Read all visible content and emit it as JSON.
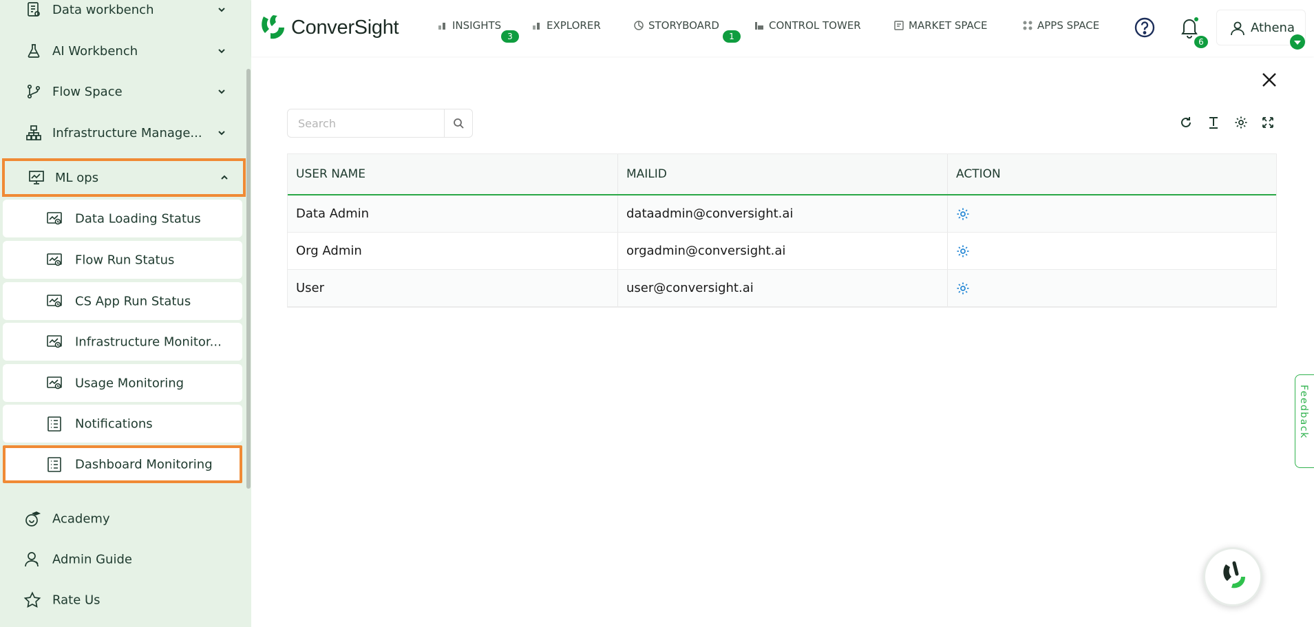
{
  "sidebar": {
    "items": [
      {
        "label": "Data workbench",
        "icon": "data-workbench-icon"
      },
      {
        "label": "AI Workbench",
        "icon": "flask-icon"
      },
      {
        "label": "Flow Space",
        "icon": "branch-icon"
      },
      {
        "label": "Infrastructure Manage...",
        "icon": "hierarchy-icon"
      },
      {
        "label": "ML ops",
        "icon": "presentation-chart-icon"
      }
    ],
    "sub_items": [
      {
        "label": "Data Loading Status"
      },
      {
        "label": "Flow Run Status"
      },
      {
        "label": "CS App Run Status"
      },
      {
        "label": "Infrastructure Monitor..."
      },
      {
        "label": "Usage Monitoring"
      },
      {
        "label": "Notifications"
      },
      {
        "label": "Dashboard Monitoring"
      }
    ],
    "footer": [
      {
        "label": "Academy"
      },
      {
        "label": "Admin Guide"
      },
      {
        "label": "Rate Us"
      }
    ]
  },
  "header": {
    "brand": "ConverSight",
    "nav": [
      {
        "label": "INSIGHTS",
        "badge": "3"
      },
      {
        "label": "EXPLORER"
      },
      {
        "label": "STORYBOARD",
        "badge": "1"
      },
      {
        "label": "CONTROL TOWER"
      },
      {
        "label": "MARKET SPACE"
      },
      {
        "label": "APPS SPACE"
      }
    ],
    "notifications_count": "6",
    "user_name": "Athena"
  },
  "search": {
    "placeholder": "Search",
    "value": ""
  },
  "table": {
    "columns": [
      "USER NAME",
      "MAILID",
      "ACTION"
    ],
    "rows": [
      {
        "user_name": "Data Admin",
        "mail": "dataadmin@conversight.ai"
      },
      {
        "user_name": "Org Admin",
        "mail": "orgadmin@conversight.ai"
      },
      {
        "user_name": "User",
        "mail": "user@conversight.ai"
      }
    ]
  },
  "feedback_label": "Feedback",
  "colors": {
    "sidebar_bg": "#e6f2e6",
    "highlight": "#f08a35",
    "accent_green": "#0f9d3f",
    "action_blue": "#2a8ad6"
  }
}
